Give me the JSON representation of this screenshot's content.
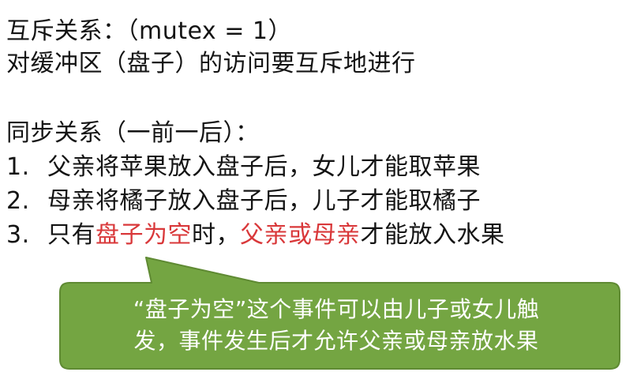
{
  "mutex_line": "互斥关系：（mutex = 1）",
  "mutex_desc": "对缓冲区（盘子）的访问要互斥地进行",
  "sync_title": "同步关系（一前一后）：",
  "sync_items": [
    {
      "num": "1.",
      "text": "父亲将苹果放入盘子后，女儿才能取苹果"
    },
    {
      "num": "2.",
      "text": "母亲将橘子放入盘子后，儿子才能取橘子"
    }
  ],
  "item3": {
    "num": "3.",
    "pre": "只有",
    "red1": "盘子为空",
    "mid": "时，",
    "red2": "父亲或母亲",
    "post": "才能放入水果"
  },
  "callout": {
    "line1": "“盘子为空”这个事件可以由儿子或女儿触",
    "line2": "发，事件发生后才允许父亲或母亲放水果"
  },
  "colors": {
    "text": "#141414",
    "highlight": "#d9383a",
    "callout_fill": "#74a542",
    "callout_border": "#5f8a33"
  }
}
